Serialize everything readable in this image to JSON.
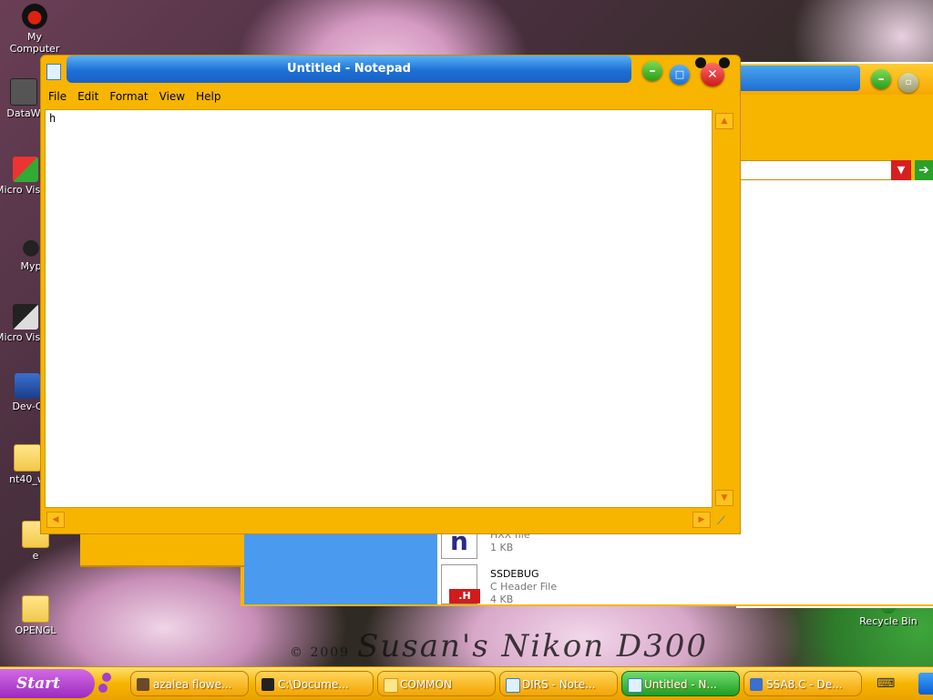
{
  "desktop": {
    "icons": [
      {
        "label": "My Computer"
      },
      {
        "label": "DataW"
      },
      {
        "label": "Micro Visual"
      },
      {
        "label": "Myp"
      },
      {
        "label": "Micro Visual"
      },
      {
        "label": "Dev-C"
      },
      {
        "label": "nt40_w"
      },
      {
        "label": "e"
      },
      {
        "label": "OPENGL"
      },
      {
        "label": "Recycle Bin"
      }
    ],
    "watermark_year": "© 2009",
    "watermark_text": "Susan's Nikon D300"
  },
  "notepad": {
    "title": "Untitled - Notepad",
    "menu": [
      "File",
      "Edit",
      "Format",
      "View",
      "Help"
    ],
    "content": "h"
  },
  "background_explorer": {
    "files": [
      {
        "name": "",
        "type": "HXX file",
        "size": "1 KB"
      },
      {
        "name": "SSDEBUG",
        "type": "C Header File",
        "size": "4 KB"
      }
    ]
  },
  "taskbar": {
    "start_label": "Start",
    "tasks": [
      {
        "label": "azalea flowe...",
        "icon": "explorer-icon",
        "active": false
      },
      {
        "label": "C:\\Docume...",
        "icon": "7zip-icon",
        "active": false
      },
      {
        "label": "COMMON",
        "icon": "folder-icon",
        "active": false
      },
      {
        "label": "DIRS - Note...",
        "icon": "notepad-icon",
        "active": false
      },
      {
        "label": "Untitled - N...",
        "icon": "notepad-icon",
        "active": true
      },
      {
        "label": "SSA8.C - De...",
        "icon": "devcpp-icon",
        "active": false
      }
    ]
  },
  "colors": {
    "accent": "#f7b500",
    "titlebar": "#1d6fd6",
    "active_task": "#1f9d1f"
  }
}
